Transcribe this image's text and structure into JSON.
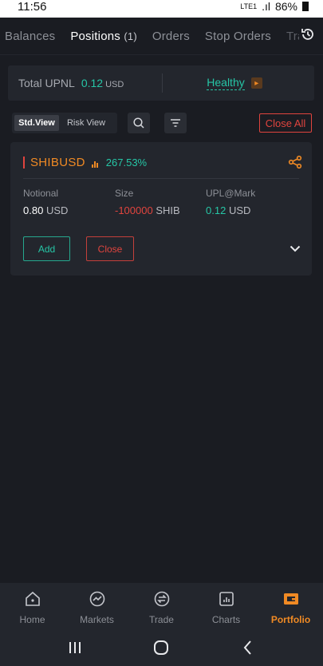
{
  "status_bar": {
    "time": "11:56",
    "network": "LTE1",
    "battery": "86%"
  },
  "top_tabs": [
    {
      "label": "Balances",
      "count": ""
    },
    {
      "label": "Positions",
      "count": "(1)"
    },
    {
      "label": "Orders",
      "count": ""
    },
    {
      "label": "Stop Orders",
      "count": ""
    },
    {
      "label": "Tra",
      "count": ""
    }
  ],
  "upnl": {
    "label": "Total UPNL",
    "value": "0.12",
    "unit": "USD",
    "health": "Healthy"
  },
  "toolbar": {
    "std_view": "Std.View",
    "risk_view": "Risk View",
    "close_all": "Close All"
  },
  "position": {
    "symbol": "SHIBUSD",
    "pnl_pct": "267.53%",
    "notional_label": "Notional",
    "notional_value": "0.80",
    "notional_unit": "USD",
    "size_label": "Size",
    "size_value": "-100000",
    "size_unit": "SHIB",
    "upl_label": "UPL@Mark",
    "upl_value": "0.12",
    "upl_unit": "USD",
    "add_label": "Add",
    "close_label": "Close"
  },
  "bottom_nav": [
    {
      "label": "Home",
      "icon": "home-icon"
    },
    {
      "label": "Markets",
      "icon": "markets-icon"
    },
    {
      "label": "Trade",
      "icon": "trade-icon"
    },
    {
      "label": "Charts",
      "icon": "charts-icon"
    },
    {
      "label": "Portfolio",
      "icon": "portfolio-icon"
    }
  ],
  "colors": {
    "accent": "#f08a24",
    "positive": "#26c6a6",
    "negative": "#e0443e",
    "background": "#1a1c22",
    "card": "#23262d"
  }
}
